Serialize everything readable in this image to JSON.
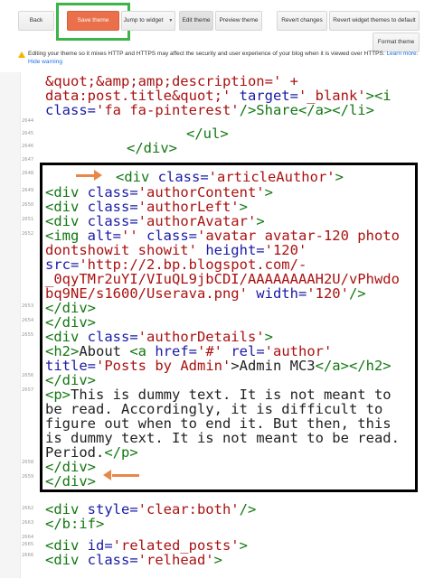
{
  "toolbar": {
    "back": "Back",
    "save_theme": "Save theme",
    "jump_to_widget": "Jump to widget",
    "edit_theme": "Edit theme",
    "preview_theme": "Preview theme",
    "revert_changes": "Revert changes",
    "revert_widget_themes": "Revert widget themes to default",
    "format_theme": "Format theme"
  },
  "warning": {
    "text": "Editing your theme so it mixes HTTP and HTTPS may affect the security and user experience of your blog when it is viewed over HTTPS.",
    "learn_more": "Learn more.",
    "hide_warning": "Hide warning"
  },
  "line_numbers": [
    "2644",
    "2645",
    "2646",
    "2647",
    "2648",
    "2649",
    "2650",
    "2651",
    "2652",
    "2653",
    "2654",
    "2655",
    "2656",
    "2657",
    "2658",
    "2659",
    "2660",
    "2661",
    "2662",
    "2663",
    "2664",
    "2665",
    "2666"
  ],
  "code": {
    "l0": "&quot;&amp;amp;description=' +",
    "l1a": "data:post.title&quot;'",
    "l1b": " target=",
    "l1c": "'_blank'",
    "l1d": "><i",
    "l2a": "class=",
    "l2b": "'fa fa-pinterest'",
    "l2c": "/>Share",
    "l2d": "</a></li>",
    "l3": "</ul>",
    "l4": "</div>",
    "l5a": "<div",
    "l5b": " class=",
    "l5c": "'articleAuthor'",
    "l5d": ">",
    "l6a": "<div",
    "l6b": " class=",
    "l6c": "'authorContent'",
    "l6d": ">",
    "l7a": "<div",
    "l7b": " class=",
    "l7c": "'authorLeft'",
    "l7d": ">",
    "l8a": "<div",
    "l8b": " class=",
    "l8c": "'authorAvatar'",
    "l8d": ">",
    "l9a": "<img",
    "l9b": " alt=",
    "l9c": "''",
    "l9d": " class=",
    "l9e": "'avatar avatar-120 photo",
    "l10a": "dontshowit showit'",
    "l10b": " height=",
    "l10c": "'120'",
    "l11a": "src=",
    "l11b": "'http://2.bp.blogspot.com/-",
    "l12": "_0qyTMr2uYI/VIuQL9jbCDI/AAAAAAAAH2U/vPhwdo",
    "l13a": "bq9NE/s1600/Userava.png'",
    "l13b": " width=",
    "l13c": "'120'",
    "l13d": "/>",
    "l14": "</div>",
    "l15": "</div>",
    "l16a": "<div",
    "l16b": " class=",
    "l16c": "'authorDetails'",
    "l16d": ">",
    "l17a": "<h2>",
    "l17b": "About ",
    "l17c": "<a",
    "l17d": " href=",
    "l17e": "'#'",
    "l17f": " rel=",
    "l17g": "'author'",
    "l18a": "title=",
    "l18b": "'Posts by Admin'",
    "l18c": ">Admin MC3",
    "l18d": "</a></h2>",
    "l19": "</div>",
    "l20a": "<p>",
    "l20b": "This is dummy text. It is not meant to",
    "l21": "be read. Accordingly, it is difficult to",
    "l22": "figure out when to end it. But then, this",
    "l23": "is dummy text. It is not meant to be read.",
    "l24a": "Period.",
    "l24b": "</p>",
    "l25": "</div>",
    "l26": "</div>",
    "l27a": "<div",
    "l27b": " style=",
    "l27c": "'clear:both'",
    "l27d": "/>",
    "l28": "</b:if>",
    "l29a": "<div",
    "l29b": " id=",
    "l29c": "'related_posts'",
    "l29d": ">",
    "l30a": "<div",
    "l30b": " class=",
    "l30c": "'relhead'",
    "l30d": ">"
  },
  "colors": {
    "save_button": "#e9704a",
    "highlight_box": "#3bb44a",
    "annotation_arrow": "#e8874a",
    "tag": "#117711",
    "attr": "#1a1aa6",
    "string": "#aa1111"
  }
}
